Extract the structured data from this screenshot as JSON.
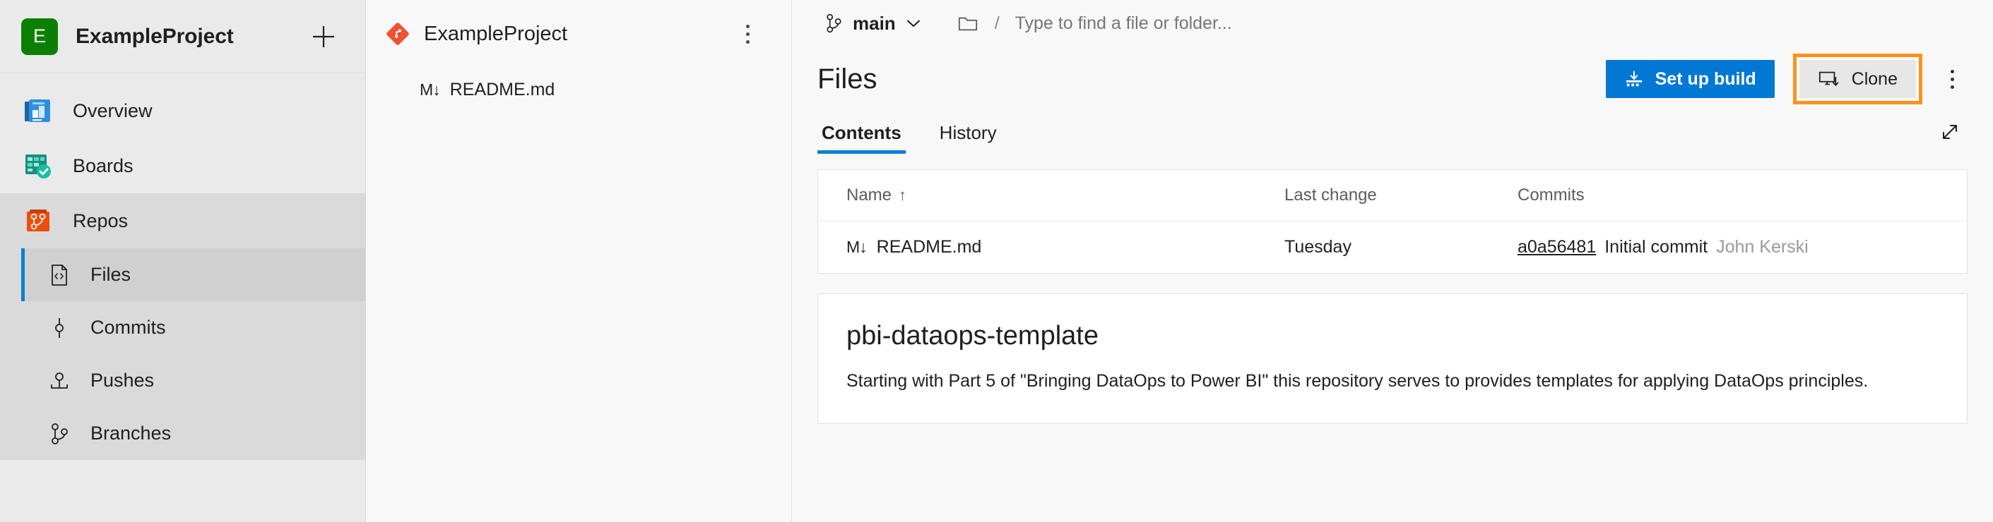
{
  "sidebar": {
    "project": {
      "avatar_letter": "E",
      "name": "ExampleProject",
      "avatar_color": "#0b8000",
      "add_label": "+"
    },
    "items": [
      {
        "label": "Overview",
        "icon": "overview-icon",
        "selected": false
      },
      {
        "label": "Boards",
        "icon": "boards-icon",
        "selected": false
      },
      {
        "label": "Repos",
        "icon": "repos-icon",
        "selected": false
      }
    ],
    "sub_items": [
      {
        "label": "Files",
        "icon": "files-icon",
        "selected": true
      },
      {
        "label": "Commits",
        "icon": "commits-icon",
        "selected": false
      },
      {
        "label": "Pushes",
        "icon": "pushes-icon",
        "selected": false
      },
      {
        "label": "Branches",
        "icon": "branches-icon",
        "selected": false
      }
    ]
  },
  "tree": {
    "repo_name": "ExampleProject",
    "repo_icon": "git-repo-icon",
    "more_icon": "kebab-menu-icon",
    "items": [
      {
        "label": "README.md",
        "icon": "markdown-icon",
        "icon_text": "M↓"
      }
    ]
  },
  "breadcrumb": {
    "branch": "main",
    "branch_icon": "branch-icon",
    "chevron_icon": "chevron-down-icon",
    "folder_icon": "folder-icon",
    "separator": "/",
    "search_placeholder": "Type to find a file or folder...",
    "search_value": ""
  },
  "header": {
    "title": "Files",
    "setup_build_label": "Set up build",
    "setup_build_icon": "build-icon",
    "clone_label": "Clone",
    "clone_icon": "monitor-download-icon",
    "more_icon": "kebab-menu-icon",
    "primary_color": "#0078d4",
    "highlight_color": "#f7941e"
  },
  "tabs": {
    "items": [
      {
        "label": "Contents",
        "active": true
      },
      {
        "label": "History",
        "active": false
      }
    ],
    "expand_icon": "expand-diagonal-icon"
  },
  "files_table": {
    "columns": [
      {
        "label": "Name",
        "sort": "↑"
      },
      {
        "label": "Last change",
        "sort": ""
      },
      {
        "label": "Commits",
        "sort": ""
      }
    ],
    "rows": [
      {
        "icon_text": "M↓",
        "name": "README.md",
        "last_change": "Tuesday",
        "commit_hash": "a0a56481",
        "commit_message": "Initial commit",
        "commit_author": "John Kerski"
      }
    ]
  },
  "readme": {
    "title": "pbi-dataops-template",
    "body": "Starting with Part 5 of \"Bringing DataOps to Power BI\" this repository serves to provides templates for applying DataOps principles."
  }
}
